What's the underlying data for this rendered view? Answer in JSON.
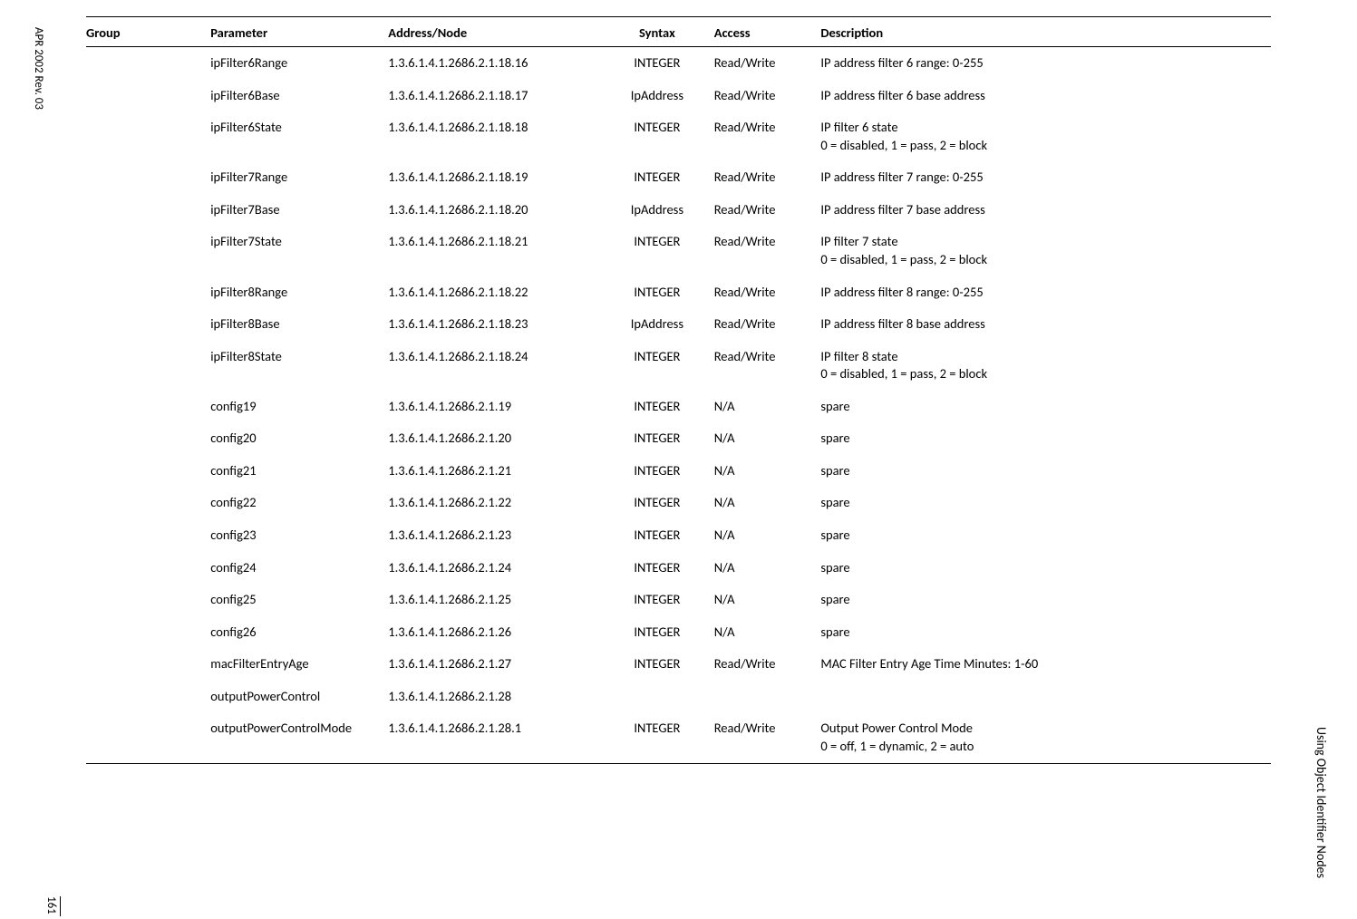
{
  "headers": {
    "group": "Group",
    "parameter": "Parameter",
    "address": "Address/Node",
    "syntax": "Syntax",
    "access": "Access",
    "description": "Description"
  },
  "rows": [
    {
      "parameter": "ipFilter6Range",
      "address": "1.3.6.1.4.1.2686.2.1.18.16",
      "syntax": "INTEGER",
      "access": "Read/Write",
      "description": "IP address filter 6 range: 0-255"
    },
    {
      "parameter": "ipFilter6Base",
      "address": "1.3.6.1.4.1.2686.2.1.18.17",
      "syntax": "IpAddress",
      "access": "Read/Write",
      "description": "IP address filter 6 base address"
    },
    {
      "parameter": "ipFilter6State",
      "address": "1.3.6.1.4.1.2686.2.1.18.18",
      "syntax": "INTEGER",
      "access": "Read/Write",
      "description": "IP filter 6 state\n0 = disabled, 1 = pass, 2 = block"
    },
    {
      "parameter": "ipFilter7Range",
      "address": "1.3.6.1.4.1.2686.2.1.18.19",
      "syntax": "INTEGER",
      "access": "Read/Write",
      "description": "IP address filter 7 range: 0-255"
    },
    {
      "parameter": "ipFilter7Base",
      "address": "1.3.6.1.4.1.2686.2.1.18.20",
      "syntax": "IpAddress",
      "access": "Read/Write",
      "description": "IP address filter 7 base address"
    },
    {
      "parameter": "ipFilter7State",
      "address": "1.3.6.1.4.1.2686.2.1.18.21",
      "syntax": "INTEGER",
      "access": "Read/Write",
      "description": "IP filter 7 state\n0 = disabled, 1 = pass, 2 = block"
    },
    {
      "parameter": "ipFilter8Range",
      "address": "1.3.6.1.4.1.2686.2.1.18.22",
      "syntax": "INTEGER",
      "access": "Read/Write",
      "description": "IP address filter 8 range: 0-255"
    },
    {
      "parameter": "ipFilter8Base",
      "address": "1.3.6.1.4.1.2686.2.1.18.23",
      "syntax": "IpAddress",
      "access": "Read/Write",
      "description": "IP address filter 8 base address"
    },
    {
      "parameter": "ipFilter8State",
      "address": "1.3.6.1.4.1.2686.2.1.18.24",
      "syntax": "INTEGER",
      "access": "Read/Write",
      "description": "IP filter 8 state\n0 = disabled, 1 = pass, 2 = block"
    },
    {
      "parameter": "config19",
      "address": "1.3.6.1.4.1.2686.2.1.19",
      "syntax": "INTEGER",
      "access": "N/A",
      "description": "spare"
    },
    {
      "parameter": "config20",
      "address": "1.3.6.1.4.1.2686.2.1.20",
      "syntax": "INTEGER",
      "access": "N/A",
      "description": "spare"
    },
    {
      "parameter": "config21",
      "address": "1.3.6.1.4.1.2686.2.1.21",
      "syntax": "INTEGER",
      "access": "N/A",
      "description": "spare"
    },
    {
      "parameter": "config22",
      "address": "1.3.6.1.4.1.2686.2.1.22",
      "syntax": "INTEGER",
      "access": "N/A",
      "description": "spare"
    },
    {
      "parameter": "config23",
      "address": "1.3.6.1.4.1.2686.2.1.23",
      "syntax": "INTEGER",
      "access": "N/A",
      "description": "spare"
    },
    {
      "parameter": "config24",
      "address": "1.3.6.1.4.1.2686.2.1.24",
      "syntax": "INTEGER",
      "access": "N/A",
      "description": "spare"
    },
    {
      "parameter": "config25",
      "address": "1.3.6.1.4.1.2686.2.1.25",
      "syntax": "INTEGER",
      "access": "N/A",
      "description": "spare"
    },
    {
      "parameter": "config26",
      "address": "1.3.6.1.4.1.2686.2.1.26",
      "syntax": "INTEGER",
      "access": "N/A",
      "description": "spare"
    },
    {
      "parameter": "macFilterEntryAge",
      "address": "1.3.6.1.4.1.2686.2.1.27",
      "syntax": "INTEGER",
      "access": "Read/Write",
      "description": "MAC Filter Entry Age Time Minutes: 1-60"
    },
    {
      "parameter": "outputPowerControl",
      "address": "1.3.6.1.4.1.2686.2.1.28",
      "syntax": "",
      "access": "",
      "description": ""
    },
    {
      "parameter": "outputPowerControlMode",
      "address": "1.3.6.1.4.1.2686.2.1.28.1",
      "syntax": "INTEGER",
      "access": "Read/Write",
      "description": "Output Power Control Mode\n0 = off, 1 = dynamic, 2 = auto"
    }
  ],
  "footer_left": "APR 2002 Rev. 03",
  "footer_right": "Using Object Identifier Nodes",
  "page_number": "161"
}
